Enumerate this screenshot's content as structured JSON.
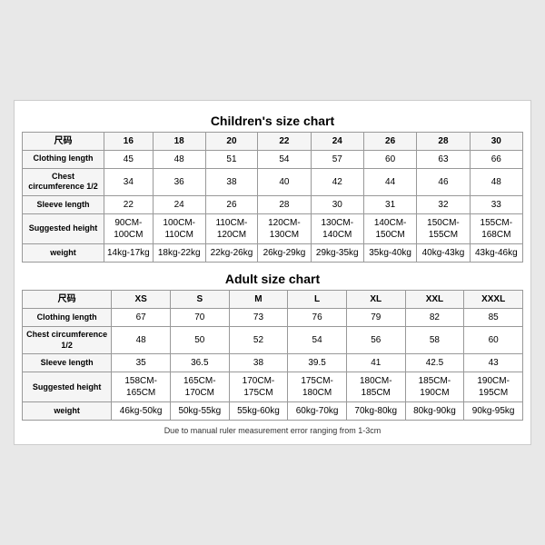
{
  "children": {
    "title": "Children's size chart",
    "headers": [
      "尺码",
      "16",
      "18",
      "20",
      "22",
      "24",
      "26",
      "28",
      "30"
    ],
    "rows": [
      {
        "label": "Clothing length",
        "values": [
          "45",
          "48",
          "51",
          "54",
          "57",
          "60",
          "63",
          "66"
        ]
      },
      {
        "label": "Chest circumference 1/2",
        "values": [
          "34",
          "36",
          "38",
          "40",
          "42",
          "44",
          "46",
          "48"
        ]
      },
      {
        "label": "Sleeve length",
        "values": [
          "22",
          "24",
          "26",
          "28",
          "30",
          "31",
          "32",
          "33"
        ]
      },
      {
        "label": "Suggested height",
        "values": [
          "90CM-100CM",
          "100CM-110CM",
          "110CM-120CM",
          "120CM-130CM",
          "130CM-140CM",
          "140CM-150CM",
          "150CM-155CM",
          "155CM-168CM"
        ]
      },
      {
        "label": "weight",
        "values": [
          "14kg-17kg",
          "18kg-22kg",
          "22kg-26kg",
          "26kg-29kg",
          "29kg-35kg",
          "35kg-40kg",
          "40kg-43kg",
          "43kg-46kg"
        ]
      }
    ]
  },
  "adult": {
    "title": "Adult size chart",
    "headers": [
      "尺码",
      "XS",
      "S",
      "M",
      "L",
      "XL",
      "XXL",
      "XXXL"
    ],
    "rows": [
      {
        "label": "Clothing length",
        "values": [
          "67",
          "70",
          "73",
          "76",
          "79",
          "82",
          "85"
        ]
      },
      {
        "label": "Chest circumference 1/2",
        "values": [
          "48",
          "50",
          "52",
          "54",
          "56",
          "58",
          "60"
        ]
      },
      {
        "label": "Sleeve length",
        "values": [
          "35",
          "36.5",
          "38",
          "39.5",
          "41",
          "42.5",
          "43"
        ]
      },
      {
        "label": "Suggested height",
        "values": [
          "158CM-165CM",
          "165CM-170CM",
          "170CM-175CM",
          "175CM-180CM",
          "180CM-185CM",
          "185CM-190CM",
          "190CM-195CM"
        ]
      },
      {
        "label": "weight",
        "values": [
          "46kg-50kg",
          "50kg-55kg",
          "55kg-60kg",
          "60kg-70kg",
          "70kg-80kg",
          "80kg-90kg",
          "90kg-95kg"
        ]
      }
    ]
  },
  "note": "Due to manual ruler measurement error ranging from 1-3cm"
}
